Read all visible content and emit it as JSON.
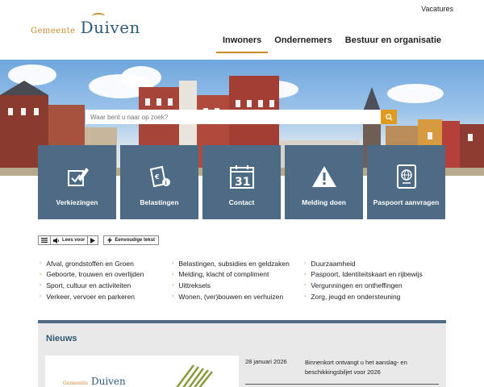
{
  "top_links": {
    "vacatures": "Vacatures"
  },
  "logo": {
    "small": "Gemeente",
    "big": "Duiven"
  },
  "nav": [
    {
      "label": "Inwoners",
      "active": true
    },
    {
      "label": "Ondernemers",
      "active": false
    },
    {
      "label": "Bestuur en organisatie",
      "active": false
    }
  ],
  "search": {
    "placeholder": "Waar bent u naar op zoek?"
  },
  "tiles": [
    {
      "label": "Verkiezingen",
      "icon": "pencil-check-icon"
    },
    {
      "label": "Belastingen",
      "icon": "tax-document-icon"
    },
    {
      "label": "Contact",
      "icon": "calendar-icon",
      "number": "31"
    },
    {
      "label": "Melding doen",
      "icon": "warning-icon"
    },
    {
      "label": "Paspoort aanvragen",
      "icon": "passport-icon"
    }
  ],
  "readspeaker": {
    "listen": "Lees voor",
    "simple": "Eenvoudige tekst"
  },
  "links": [
    [
      "Afval, grondstoffen en Groen",
      "Geboorte, trouwen en overlijden",
      "Sport, cultuur en activiteiten",
      "Verkeer, vervoer en parkeren"
    ],
    [
      "Belastingen, subsidies en geldzaken",
      "Melding, klacht of compliment",
      "Uittreksels",
      "Wonen, (ver)bouwen en verhuizen"
    ],
    [
      "Duurzaamheid",
      "Paspoort, Identiteitskaart en rijbewijs",
      "Vergunningen en ontheffingen",
      "Zorg, jeugd en ondersteuning"
    ]
  ],
  "news": {
    "title": "Nieuws",
    "card_logo_small": "Gemeente",
    "card_logo_big": "Duiven",
    "date": "28 januari 2026",
    "headline": "Binnenkort ontvangt u het aanslag- en beschikkingsbiljet voor 2026"
  },
  "colors": {
    "accent": "#c98a2e",
    "tile": "#4d6b84",
    "brand": "#2f5a74",
    "search_button": "#e09a1e"
  }
}
